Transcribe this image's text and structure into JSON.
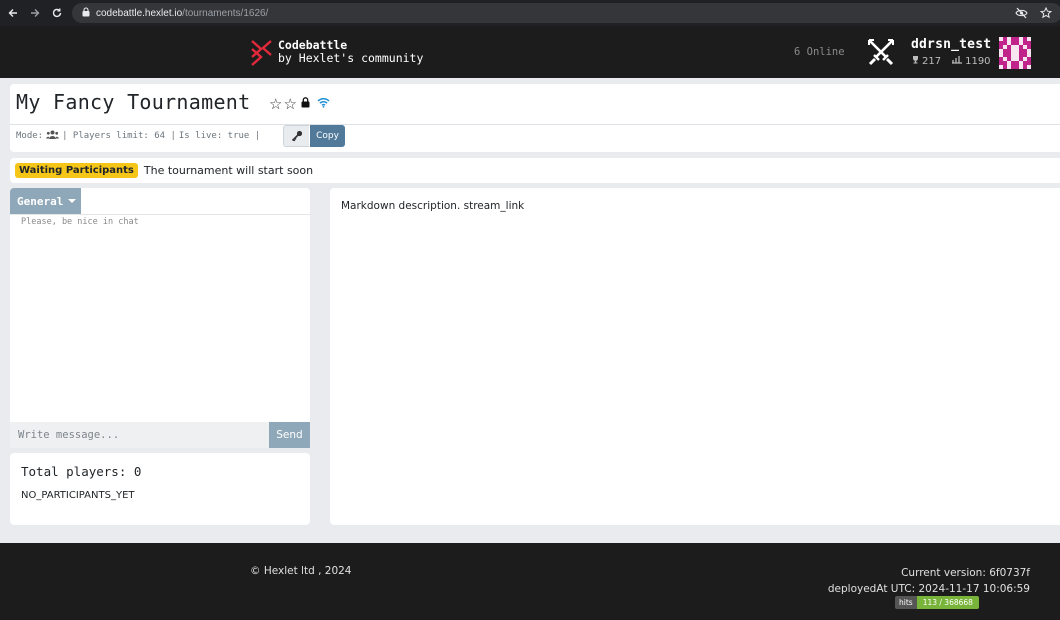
{
  "browser": {
    "url_host": "codebattle.hexlet.io",
    "url_path": "/tournaments/1626/"
  },
  "header": {
    "brand": "Codebattle",
    "tagline": "by Hexlet's community",
    "online": "6 Online",
    "username": "ddrsn_test",
    "rating": "217",
    "points": "1190"
  },
  "tournament": {
    "title": "My Fancy Tournament",
    "mode_label": "Mode:",
    "players_limit": "| Players limit: 64 |",
    "is_live": "Is live: true |",
    "copy_label": "Copy"
  },
  "status": {
    "badge": "Waiting Participants",
    "message": "The tournament will start soon"
  },
  "chat": {
    "tab_label": "General",
    "hint": "Please, be nice in chat",
    "input_placeholder": "Write message...",
    "send_label": "Send"
  },
  "players": {
    "title": "Total players: 0",
    "empty": "NO_PARTICIPANTS_YET"
  },
  "description": {
    "text": "Markdown description. stream_link"
  },
  "footer": {
    "copyright": "© Hexlet ltd , 2024",
    "version": "Current version: 6f0737f",
    "deployed": "deployedAt UTC: 2024-11-17 10:06:59",
    "hits_label": "hits",
    "hits_value": "113 / 368668"
  },
  "colors": {
    "accent": "#517a9a",
    "badge": "#f5c518",
    "header_bg": "#1c1c1c",
    "logo_red": "#e0293b"
  }
}
